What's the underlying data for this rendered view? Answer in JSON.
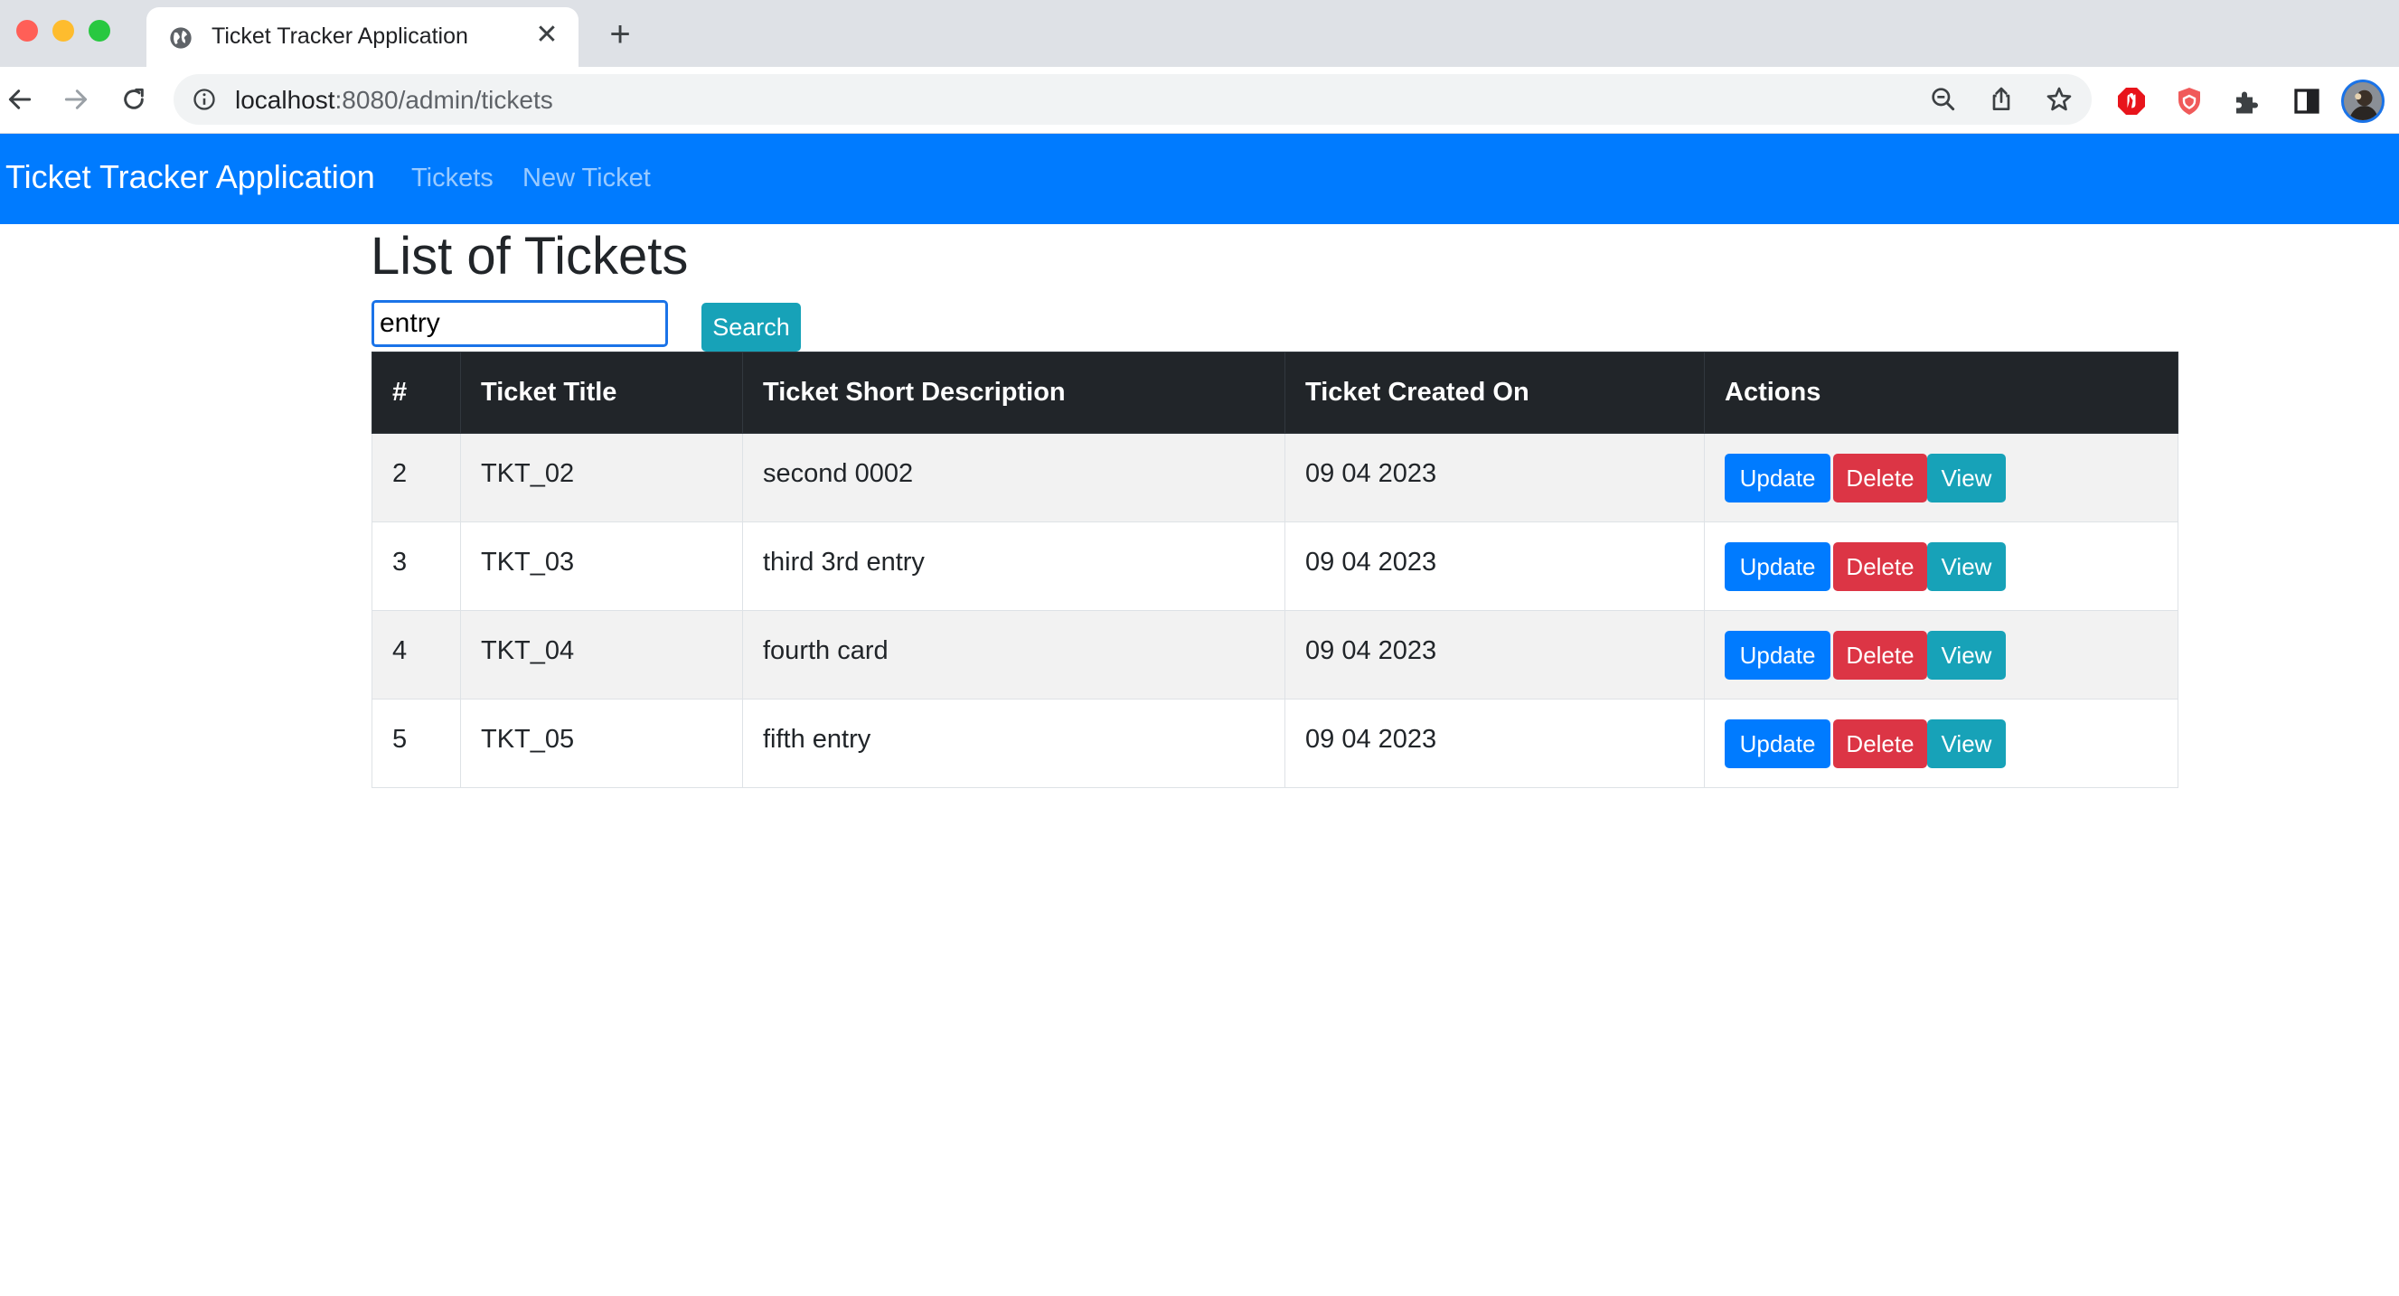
{
  "browser": {
    "tab_title": "Ticket Tracker Application",
    "url_host": "localhost",
    "url_path": ":8080/admin/tickets"
  },
  "navbar": {
    "brand": "Ticket Tracker Application",
    "links": [
      "Tickets",
      "New Ticket"
    ],
    "color": "#007bff"
  },
  "page": {
    "title": "List of Tickets",
    "search_value": "entry",
    "search_button": "Search"
  },
  "table": {
    "headers": [
      "#",
      "Ticket Title",
      "Ticket Short Description",
      "Ticket Created On",
      "Actions"
    ],
    "rows": [
      {
        "id": "2",
        "title": "TKT_02",
        "desc": "second 0002",
        "created": "09 04 2023"
      },
      {
        "id": "3",
        "title": "TKT_03",
        "desc": "third 3rd entry",
        "created": "09 04 2023"
      },
      {
        "id": "4",
        "title": "TKT_04",
        "desc": "fourth card",
        "created": "09 04 2023"
      },
      {
        "id": "5",
        "title": "TKT_05",
        "desc": "fifth entry",
        "created": "09 04 2023"
      }
    ],
    "actions": {
      "update": "Update",
      "delete": "Delete",
      "view": "View"
    }
  },
  "colors": {
    "update": "#007bff",
    "delete": "#dc3545",
    "view": "#17a2b8",
    "header_bg": "#212529"
  },
  "icons": [
    "globe-icon",
    "close-icon",
    "plus-icon",
    "back-arrow-icon",
    "forward-arrow-icon",
    "reload-icon",
    "info-icon",
    "zoom-out-icon",
    "share-icon",
    "star-icon",
    "adblock-icon",
    "shield-icon",
    "puzzle-icon",
    "sidepanel-icon",
    "avatar"
  ]
}
